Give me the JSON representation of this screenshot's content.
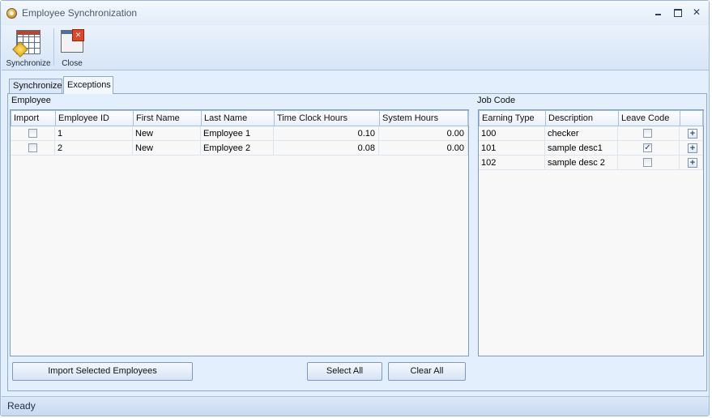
{
  "window": {
    "title": "Employee Synchronization",
    "close_glyph": "✕"
  },
  "toolbar": {
    "synchronize_label": "Synchronize",
    "close_label": "Close"
  },
  "tabs": [
    {
      "label": "Synchronize"
    },
    {
      "label": "Exceptions"
    }
  ],
  "employee": {
    "group_label": "Employee",
    "columns": [
      "Import",
      "Employee ID",
      "First Name",
      "Last Name",
      "Time Clock Hours",
      "System Hours"
    ],
    "rows": [
      {
        "import": false,
        "employee_id": "1",
        "first_name": "New",
        "last_name": "Employee 1",
        "time_clock_hours": "0.10",
        "system_hours": "0.00"
      },
      {
        "import": false,
        "employee_id": "2",
        "first_name": "New",
        "last_name": "Employee 2",
        "time_clock_hours": "0.08",
        "system_hours": "0.00"
      }
    ]
  },
  "job_code": {
    "group_label": "Job Code",
    "columns": [
      "Earning Type",
      "Description",
      "Leave Code",
      ""
    ],
    "rows": [
      {
        "earning_type": "100",
        "description": "checker",
        "leave_code": false,
        "action": "+"
      },
      {
        "earning_type": "101",
        "description": "sample desc1",
        "leave_code": true,
        "action": "+"
      },
      {
        "earning_type": "102",
        "description": "sample desc 2",
        "leave_code": false,
        "action": "+"
      }
    ]
  },
  "buttons": {
    "import_selected": "Import Selected Employees",
    "select_all": "Select All",
    "clear_all": "Clear All"
  },
  "status": {
    "text": "Ready"
  }
}
